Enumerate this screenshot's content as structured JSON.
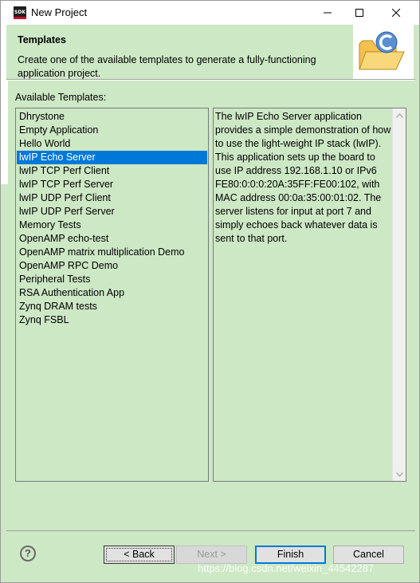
{
  "window": {
    "title": "New Project",
    "icon_text": "SDK"
  },
  "banner": {
    "title": "Templates",
    "description": "Create one of the available templates to generate a fully-functioning application project.",
    "icon": "folder-c-wizard-icon"
  },
  "templates": {
    "label": "Available Templates:",
    "items": [
      "Dhrystone",
      "Empty Application",
      "Hello World",
      "lwIP Echo Server",
      "lwIP TCP Perf Client",
      "lwIP TCP Perf Server",
      "lwIP UDP Perf Client",
      "lwIP UDP Perf Server",
      "Memory Tests",
      "OpenAMP echo-test",
      "OpenAMP matrix multiplication Demo",
      "OpenAMP RPC Demo",
      "Peripheral Tests",
      "RSA Authentication App",
      "Zynq DRAM tests",
      "Zynq FSBL"
    ],
    "selected": "lwIP Echo Server"
  },
  "description": "The lwIP Echo Server application provides a simple demonstration of how to use the light-weight IP stack (lwIP). This application sets up the board to use IP address 192.168.1.10 or IPv6 FE80:0:0:0:20A:35FF:FE00:102, with MAC address 00:0a:35:00:01:02. The server listens for input at port 7 and simply echoes back whatever data is sent to that port.",
  "buttons": {
    "help": "?",
    "back": "< Back",
    "next": "Next >",
    "finish": "Finish",
    "cancel": "Cancel"
  },
  "watermark": "https://blog.csdn.net/weixin_44542287",
  "colors": {
    "panel_bg": "#cde8c5",
    "selection": "#0078d7",
    "default_button_border": "#0078d7"
  }
}
